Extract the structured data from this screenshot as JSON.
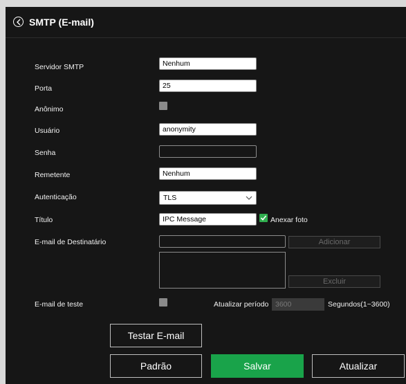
{
  "header": {
    "title": "SMTP (E-mail)"
  },
  "fields": {
    "smtp_server": {
      "label": "Servidor SMTP",
      "value": "Nenhum"
    },
    "port": {
      "label": "Porta",
      "value": "25"
    },
    "anonymous": {
      "label": "Anônimo",
      "checked": false
    },
    "user": {
      "label": "Usuário",
      "value": "anonymity"
    },
    "password": {
      "label": "Senha",
      "value": ""
    },
    "sender": {
      "label": "Remetente",
      "value": "Nenhum"
    },
    "auth": {
      "label": "Autenticação",
      "value": "TLS"
    },
    "subject": {
      "label": "Título",
      "value": "IPC Message",
      "attach_photo_label": "Anexar foto",
      "attach_photo_checked": true
    },
    "recipient": {
      "label": "E-mail de Destinatário",
      "value": "",
      "add_label": "Adicionar",
      "delete_label": "Excluir"
    },
    "test_email": {
      "label": "E-mail de teste",
      "checked": false,
      "period_label": "Atualizar período",
      "period_value": "3600",
      "seconds_label": "Segundos(1~3600)"
    }
  },
  "buttons": {
    "test_email": "Testar E-mail",
    "default": "Padrão",
    "save": "Salvar",
    "refresh": "Atualizar"
  },
  "colors": {
    "background": "#161616",
    "primary": "#19a34a",
    "checkbox_checked": "#2fae4e"
  },
  "icons": {
    "back": "chevron-left-circle-icon",
    "dropdown": "chevron-down-icon",
    "check": "check-icon"
  }
}
